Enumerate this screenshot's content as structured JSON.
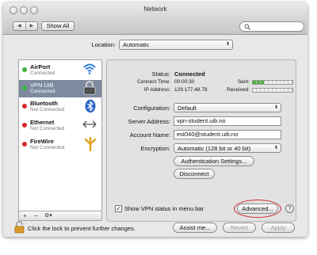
{
  "window": {
    "title": "Network",
    "show_all_label": "Show All",
    "nav_back_glyph": "◀",
    "nav_forward_glyph": "▶",
    "search_placeholder": ""
  },
  "location": {
    "label": "Location:",
    "value": "Automatic"
  },
  "sidebar": {
    "services": [
      {
        "name": "AirPort",
        "status": "Connected",
        "dot_color": "#3cb43c",
        "icon": "wifi-icon"
      },
      {
        "name": "VPN UiB",
        "status": "Connected",
        "dot_color": "#3cb43c",
        "icon": "vpn-lock-icon"
      },
      {
        "name": "Bluetooth",
        "status": "Not Connected",
        "dot_color": "#d8262b",
        "icon": "bluetooth-icon"
      },
      {
        "name": "Ethernet",
        "status": "Not Connected",
        "dot_color": "#d8262b",
        "icon": "ethernet-icon"
      },
      {
        "name": "FireWire",
        "status": "Not Connected",
        "dot_color": "#d8262b",
        "icon": "firewire-icon"
      }
    ],
    "add_label": "+",
    "remove_label": "−",
    "action_label": "⚙▾"
  },
  "vpn": {
    "status_label": "Status:",
    "status_value": "Connected",
    "connect_time_label": "Connect Time:",
    "connect_time_value": "00:00:30",
    "ip_label": "IP Address:",
    "ip_value": "129.177.48.78",
    "sent_label": "Sent:",
    "received_label": "Received:",
    "sent_level": 0.25,
    "received_level": 0,
    "configuration_label": "Configuration:",
    "configuration_value": "Default",
    "server_label": "Server Address:",
    "server_value": "vpn-student.uib.no",
    "account_label": "Account Name:",
    "account_value": "est040@student.uib.no",
    "encryption_label": "Encryption:",
    "encryption_value": "Automatic (128 bit or 40 bit)",
    "auth_button": "Authentication Settings...",
    "disconnect_button": "Disconnect",
    "show_status_label": "Show VPN status in menu bar",
    "show_status_checked": "✓",
    "advanced_button": "Advanced...",
    "help_label": "?"
  },
  "footer": {
    "lock_text": "Click the lock to prevent further changes.",
    "assist_button": "Assist me...",
    "revert_button": "Revert",
    "apply_button": "Apply"
  },
  "colors": {
    "selection": "#7d8a9f",
    "highlight_oval": "#d2272c",
    "meter_on": "#4db43d"
  }
}
